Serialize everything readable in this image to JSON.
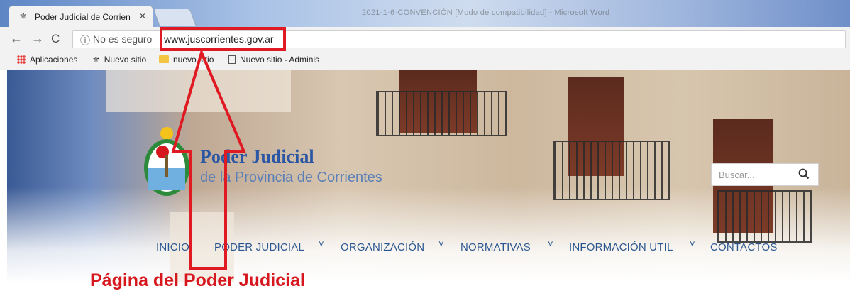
{
  "browser": {
    "tab_title": "Poder Judicial de Corrien",
    "tab_close": "×",
    "window_title": "2021-1-6-CONVENCIÓN [Modo de compatibilidad] - Microsoft Word",
    "nav_back": "←",
    "nav_forward": "→",
    "nav_reload": "C",
    "security_icon": "info-icon",
    "security_text": "No es seguro",
    "url": "www.juscorrientes.gov.ar"
  },
  "bookmarks": [
    {
      "label": "Aplicaciones",
      "icon": "apps-icon"
    },
    {
      "label": "Nuevo sitio",
      "icon": "shield-favicon"
    },
    {
      "label": "nuevo sitio",
      "icon": "folder-icon"
    },
    {
      "label": "Nuevo sitio - Adminis",
      "icon": "page-icon"
    }
  ],
  "site": {
    "title": "Poder Judicial",
    "subtitle": "de la Provincia de Corrientes",
    "search_placeholder": "Buscar...",
    "menu": [
      "INICIO",
      "PODER JUDICIAL",
      "ORGANIZACIÓN",
      "NORMATIVAS",
      "INFORMACIÓN UTIL",
      "CONTACTOS"
    ],
    "menu_chevron": "˅"
  },
  "annotation": {
    "caption": "Página del Poder Judicial",
    "color": "#d6171e"
  }
}
